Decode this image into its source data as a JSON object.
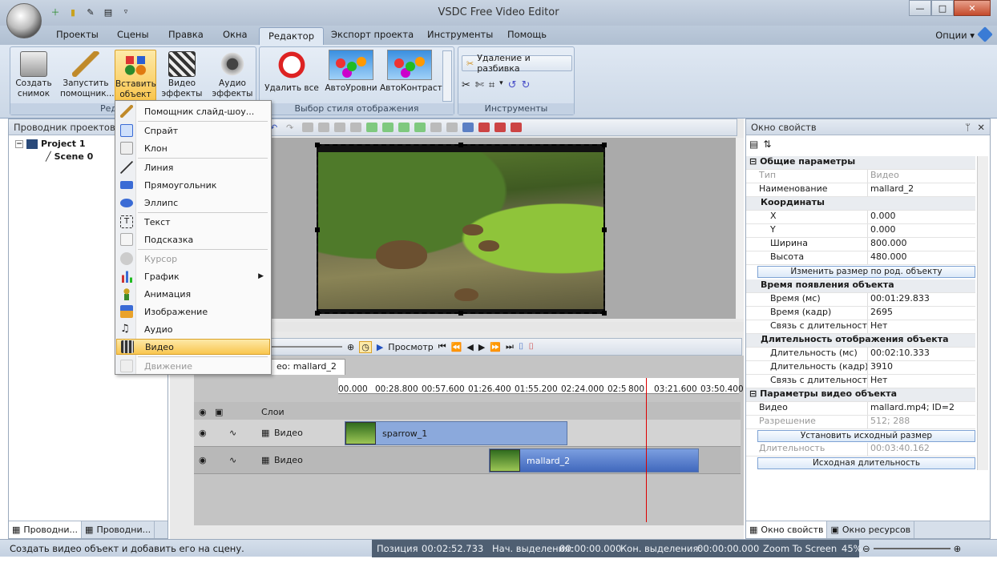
{
  "app": {
    "title": "VSDC Free Video Editor"
  },
  "window_controls": {
    "minimize": "—",
    "maximize": "□",
    "close": "✕"
  },
  "menu_tabs": [
    "Проекты",
    "Сцены",
    "Правка",
    "Окна",
    "Редактор",
    "Экспорт проекта",
    "Инструменты",
    "Помощь"
  ],
  "options_label": "Опции ▾",
  "ribbon": {
    "create_snapshot": "Создать снимок",
    "run_wizard": "Запустить помощник...",
    "insert_object": "Вставить объект",
    "video_effects": "Видео эффекты",
    "audio_effects": "Аудио эффекты",
    "group_editor": "Ред",
    "remove_all": "Удалить все",
    "auto_levels": "АвтоУровни",
    "auto_contrast": "АвтоКонтраст",
    "group_style": "Выбор стиля отображения",
    "split_btn": "Удаление и разбивка",
    "group_tools": "Инструменты"
  },
  "insert_menu": {
    "slideshow": "Помощник слайд-шоу...",
    "sprite": "Спрайт",
    "clone": "Клон",
    "line": "Линия",
    "rect": "Прямоугольник",
    "ellipse": "Эллипс",
    "text": "Текст",
    "hint": "Подсказка",
    "cursor": "Курсор",
    "chart": "График",
    "animation": "Анимация",
    "image": "Изображение",
    "audio": "Аудио",
    "video": "Видео",
    "motion": "Движение"
  },
  "left_panel": {
    "title": "Проводник проектов",
    "project": "Project 1",
    "scene": "Scene 0",
    "tab1": "Проводни...",
    "tab2": "Проводни..."
  },
  "preview": {
    "play_label": "Просмотр"
  },
  "timeline": {
    "tab_label": "eo: mallard_2",
    "layers_label": "Слои",
    "ruler_ticks": [
      "00.000",
      "00:28.800",
      "00:57.600",
      "01:26.400",
      "01:55.200",
      "02:24.000",
      "02:5",
      "800",
      "03:21.600",
      "03:50.400"
    ],
    "track1_label": "Видео",
    "track2_label": "Видео",
    "clip1": "sparrow_1",
    "clip2": "mallard_2"
  },
  "properties": {
    "title": "Окно свойств",
    "pin": "ᛘ",
    "close": "✕",
    "sec_general": "Общие параметры",
    "type_k": "Тип",
    "type_v": "Видео",
    "name_k": "Наименование",
    "name_v": "mallard_2",
    "sub_coords": "Координаты",
    "x_k": "X",
    "x_v": "0.000",
    "y_k": "Y",
    "y_v": "0.000",
    "w_k": "Ширина",
    "w_v": "800.000",
    "h_k": "Высота",
    "h_v": "480.000",
    "btn_resize": "Изменить размер по род. объекту",
    "sub_time": "Время появления объекта",
    "tms_k": "Время (мс)",
    "tms_v": "00:01:29.833",
    "tfr_k": "Время (кадр)",
    "tfr_v": "2695",
    "link1_k": "Связь с длительностью",
    "link1_v": "Нет",
    "sub_dur": "Длительность отображения объекта",
    "dms_k": "Длительность (мс)",
    "dms_v": "00:02:10.333",
    "dfr_k": "Длительность (кадр)",
    "dfr_v": "3910",
    "link2_k": "Связь с длительностью",
    "link2_v": "Нет",
    "sec_video": "Параметры видео объекта",
    "video_k": "Видео",
    "video_v": "mallard.mp4; ID=2",
    "res_k": "Разрешение",
    "res_v": "512; 288",
    "btn_orig": "Установить исходный размер",
    "len_k": "Длительность",
    "len_v": "00:03:40.162",
    "btn_len": "Исходная длительность",
    "tab1": "Окно свойств",
    "tab2": "Окно ресурсов"
  },
  "status": {
    "hint": "Создать видео объект и добавить его на сцену.",
    "pos_label": "Позиция",
    "pos_value": "00:02:52.733",
    "sel_start_label": "Нач. выделения:",
    "sel_start_value": "00:00:00.000",
    "sel_end_label": "Кон. выделения:",
    "sel_end_value": "00:00:00.000",
    "zoom_label": "Zoom To Screen",
    "zoom_value": "45%"
  }
}
